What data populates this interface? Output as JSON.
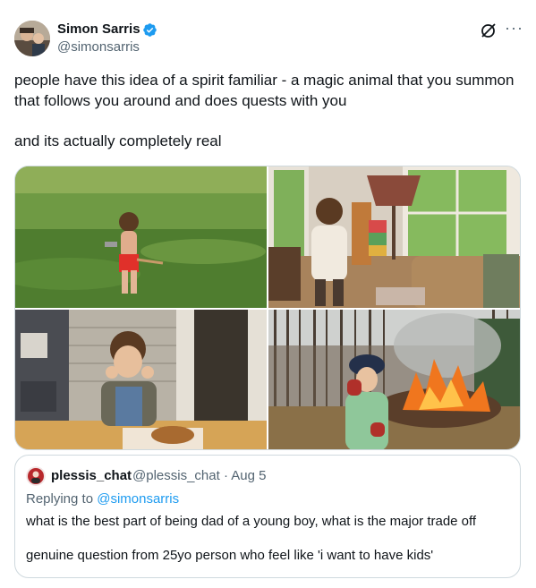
{
  "author": {
    "name": "Simon Sarris",
    "handle": "@simonsarris",
    "verified": true,
    "verified_color": "#1d9bf0"
  },
  "actions": {
    "grok_icon": "grok-icon",
    "more_icon": "more-icon",
    "more_label": "···"
  },
  "tweet": {
    "paragraphs": [
      "people have this idea of a spirit familiar - a magic animal that you summon that follows you around and does quests with you",
      "and its actually completely real"
    ]
  },
  "media": [
    {
      "name": "child-running-in-field-photo"
    },
    {
      "name": "child-stacking-blocks-photo"
    },
    {
      "name": "child-eating-at-table-photo"
    },
    {
      "name": "child-by-bonfire-photo"
    }
  ],
  "quote": {
    "name": "plessis_chat",
    "handle": "@plessis_chat",
    "separator": "·",
    "date": "Aug 5",
    "replying_prefix": "Replying to ",
    "replying_to": "@simonsarris",
    "paragraphs": [
      "what is the best part of being dad of a young boy, what is the major trade off",
      "genuine question from 25yo person who feel like 'i want to have kids'"
    ]
  }
}
